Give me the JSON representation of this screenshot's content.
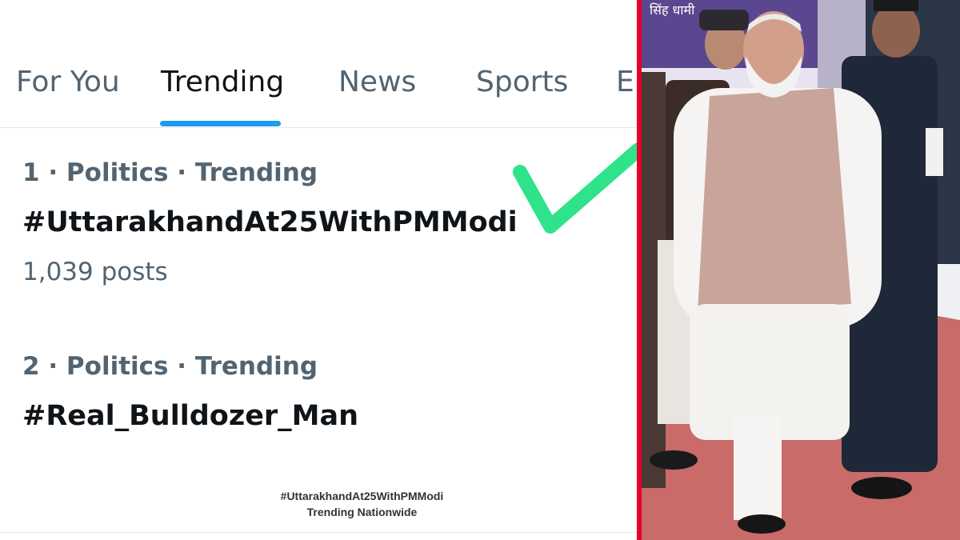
{
  "tabs": [
    {
      "label": "For You",
      "active": false
    },
    {
      "label": "Trending",
      "active": true
    },
    {
      "label": "News",
      "active": false
    },
    {
      "label": "Sports",
      "active": false
    },
    {
      "label": "E",
      "active": false
    }
  ],
  "trends": [
    {
      "meta": "1 · Politics · Trending",
      "tag": "#UttarakhandAt25WithPMModi",
      "count": "1,039 posts"
    },
    {
      "meta": "2 · Politics · Trending",
      "tag": "#Real_Bulldozer_Man"
    }
  ],
  "caption": {
    "line1": "#UttarakhandAt25WithPMModi",
    "line2": "Trending Nationwide"
  },
  "photo_banner_text": "सिंह धामी",
  "colors": {
    "accent_blue": "#1d9bf0",
    "check_green": "#2fe38a",
    "divider_red": "#e4002b",
    "muted_text": "#536471",
    "primary_text": "#0f1419"
  },
  "icons": {
    "check": "check-mark-icon"
  }
}
